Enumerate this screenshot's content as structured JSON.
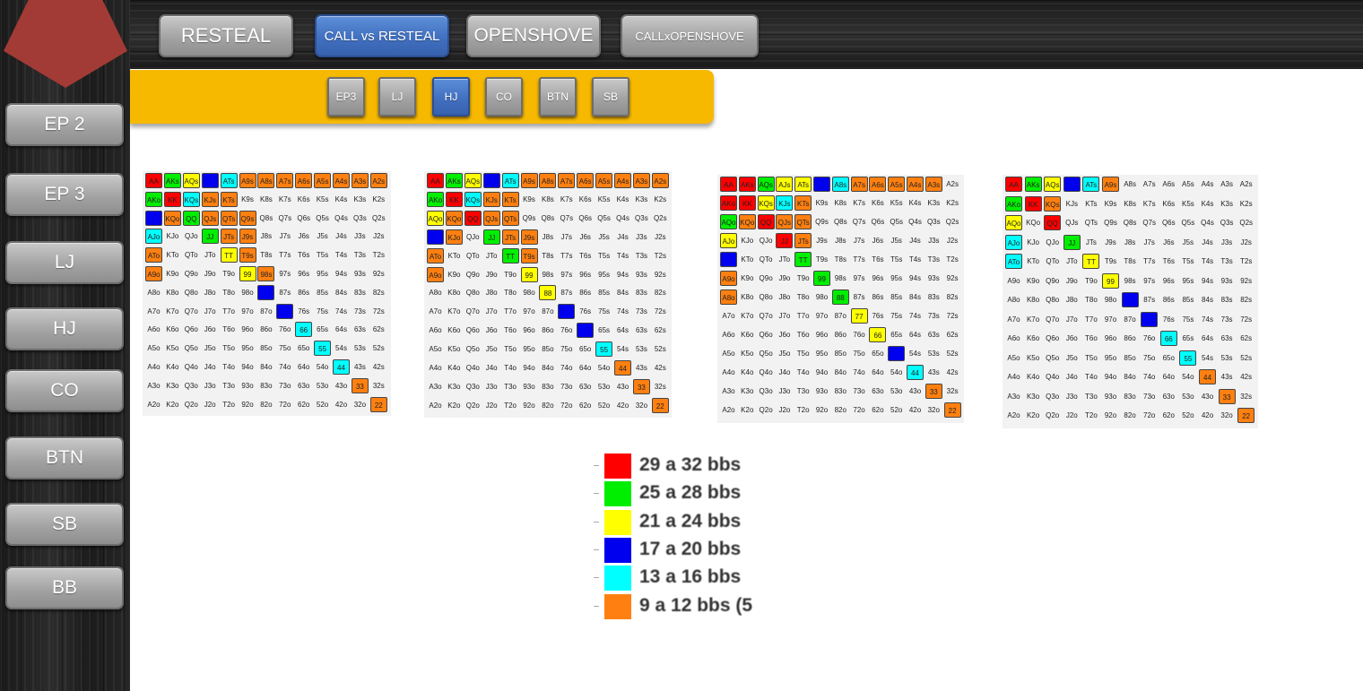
{
  "sidebar": {
    "items": [
      {
        "label": "EP 2"
      },
      {
        "label": "EP 3"
      },
      {
        "label": "LJ"
      },
      {
        "label": "HJ"
      },
      {
        "label": "CO"
      },
      {
        "label": "BTN"
      },
      {
        "label": "SB"
      },
      {
        "label": "BB"
      }
    ]
  },
  "toolbar": {
    "tabs": [
      {
        "label": "RESTEAL",
        "active": false
      },
      {
        "label": "CALL vs RESTEAL",
        "active": true
      },
      {
        "label": "OPENSHOVE",
        "active": false
      },
      {
        "label": "CALLxOPENSHOVE",
        "active": false
      }
    ]
  },
  "positions": {
    "items": [
      {
        "label": "EP3",
        "active": false
      },
      {
        "label": "LJ",
        "active": false
      },
      {
        "label": "HJ",
        "active": true
      },
      {
        "label": "CO",
        "active": false
      },
      {
        "label": "BTN",
        "active": false
      },
      {
        "label": "SB",
        "active": false
      }
    ]
  },
  "ranks": [
    "A",
    "K",
    "Q",
    "J",
    "T",
    "9",
    "8",
    "7",
    "6",
    "5",
    "4",
    "3",
    "2"
  ],
  "colors": {
    "R": "#ff0000",
    "G": "#00ee00",
    "Y": "#ffff00",
    "B": "#0000ee",
    "C": "#00ffff",
    "O": "#ff8010",
    "brand_red": "#a23b35",
    "accent_yellow": "#f6b900",
    "active_blue": "#4170c0"
  },
  "grids": [
    {
      "name": "grid-1",
      "marked": {
        "AA": "R",
        "AKs": "G",
        "AQs": "Y",
        "AJs": "B",
        "ATs": "C",
        "A9s": "O",
        "A8s": "O",
        "A7s": "O",
        "A6s": "O",
        "A5s": "O",
        "A4s": "O",
        "A3s": "O",
        "A2s": "O",
        "AKo": "G",
        "KK": "R",
        "KQs": "C",
        "KJs": "O",
        "KTs": "O",
        "AQo": "B",
        "KQo": "O",
        "QQ": "G",
        "QJs": "O",
        "QTs": "O",
        "Q9s": "O",
        "AJo": "C",
        "JJ": "G",
        "JTs": "O",
        "J9s": "O",
        "ATo": "O",
        "TT": "Y",
        "T9s": "O",
        "A9o": "O",
        "99": "Y",
        "98s": "O",
        "88": "B",
        "77": "B",
        "66": "C",
        "55": "C",
        "44": "C",
        "33": "O",
        "22": "O"
      }
    },
    {
      "name": "grid-2",
      "marked": {
        "AA": "R",
        "AKs": "G",
        "AQs": "Y",
        "AJs": "B",
        "ATs": "C",
        "A9s": "O",
        "A8s": "O",
        "A7s": "O",
        "A6s": "O",
        "A5s": "O",
        "A4s": "O",
        "A3s": "O",
        "A2s": "O",
        "AKo": "G",
        "KK": "R",
        "KQs": "C",
        "KJs": "O",
        "KTs": "O",
        "AQo": "Y",
        "KQo": "O",
        "QQ": "R",
        "QJs": "O",
        "QTs": "O",
        "AJo": "B",
        "KJo": "O",
        "JJ": "G",
        "JTs": "O",
        "J9s": "O",
        "ATo": "O",
        "TT": "G",
        "T9s": "O",
        "A9o": "O",
        "99": "Y",
        "88": "Y",
        "77": "B",
        "66": "B",
        "55": "C",
        "44": "O",
        "33": "O",
        "22": "O"
      }
    },
    {
      "name": "grid-3",
      "marked": {
        "AA": "R",
        "AKs": "R",
        "AQs": "G",
        "AJs": "Y",
        "ATs": "Y",
        "A9s": "B",
        "A8s": "C",
        "A7s": "O",
        "A6s": "O",
        "A5s": "O",
        "A4s": "O",
        "A3s": "O",
        "AKo": "R",
        "KK": "R",
        "KQs": "Y",
        "KJs": "C",
        "KTs": "O",
        "AQo": "G",
        "KQo": "O",
        "QQ": "R",
        "QJs": "O",
        "QTs": "O",
        "AJo": "Y",
        "JJ": "R",
        "JTs": "O",
        "ATo": "B",
        "TT": "G",
        "A9o": "O",
        "99": "G",
        "A8o": "O",
        "88": "G",
        "77": "Y",
        "66": "Y",
        "55": "B",
        "44": "C",
        "33": "O",
        "22": "O"
      }
    },
    {
      "name": "grid-4",
      "marked": {
        "AA": "R",
        "AKs": "G",
        "AQs": "Y",
        "AJs": "B",
        "ATs": "C",
        "A9s": "O",
        "AKo": "G",
        "KK": "R",
        "KQs": "O",
        "AQo": "Y",
        "QQ": "R",
        "AJo": "C",
        "JJ": "G",
        "ATo": "C",
        "TT": "Y",
        "99": "Y",
        "88": "B",
        "77": "B",
        "66": "C",
        "55": "C",
        "44": "O",
        "33": "O",
        "22": "O"
      }
    }
  ],
  "legend": [
    {
      "color": "R",
      "label": "29 a 32 bbs"
    },
    {
      "color": "G",
      "label": "25 a 28 bbs"
    },
    {
      "color": "Y",
      "label": "21 a 24 bbs"
    },
    {
      "color": "B",
      "label": "17 a 20 bbs"
    },
    {
      "color": "C",
      "label": "13 a 16 bbs"
    },
    {
      "color": "O",
      "label": "9 a 12 bbs (5"
    }
  ]
}
